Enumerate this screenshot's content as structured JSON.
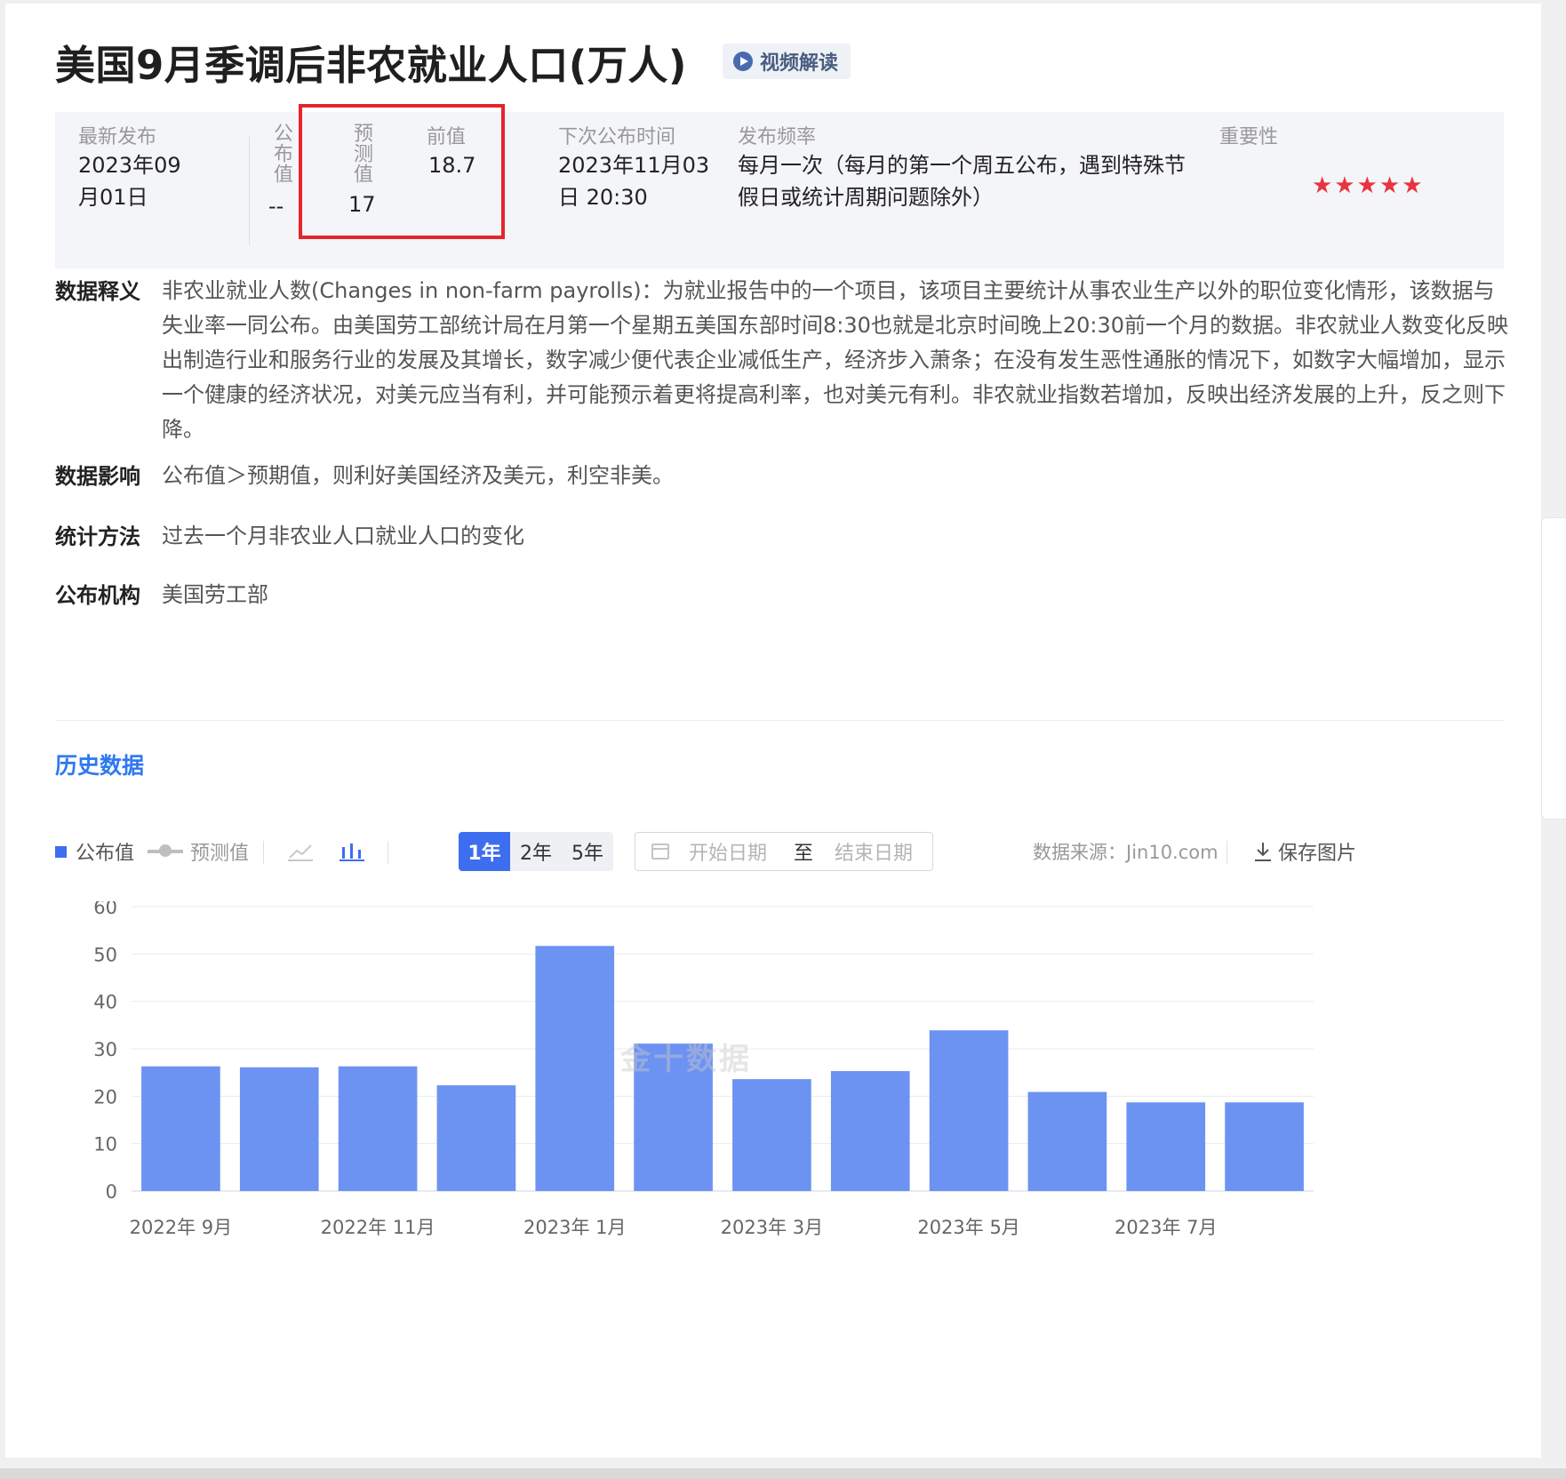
{
  "header": {
    "title": "美国9月季调后非农就业人口(万人)",
    "video_label": "视频解读"
  },
  "info": {
    "latest_label": "最新发布",
    "latest_value_line1": "2023年09",
    "latest_value_line2": "月01日",
    "actual_label": "公布值",
    "actual_value": "--",
    "forecast_label": "预测值",
    "forecast_value": "17",
    "previous_label": "前值",
    "previous_value": "18.7",
    "next_label": "下次公布时间",
    "next_value_line1": "2023年11月03",
    "next_value_line2": "日 20:30",
    "freq_label": "发布频率",
    "freq_value_line1": "每月一次（每月的第一个周五公布，遇到特殊节",
    "freq_value_line2": "假日或统计周期问题除外）",
    "importance_label": "重要性",
    "importance_stars": "★★★★★",
    "importance_color": "#e8343f"
  },
  "sections": {
    "definition_label": "数据释义",
    "definition_text": "非农业就业人数(Changes in non-farm payrolls)：为就业报告中的一个项目，该项目主要统计从事农业生产以外的职位变化情形，该数据与失业率一同公布。由美国劳工部统计局在月第一个星期五美国东部时间8:30也就是北京时间晚上20:30前一个月的数据。非农就业人数变化反映出制造行业和服务行业的发展及其增长，数字减少便代表企业减低生产，经济步入萧条；在没有发生恶性通胀的情况下，如数字大幅增加，显示一个健康的经济状况，对美元应当有利，并可能预示着更将提高利率，也对美元有利。非农就业指数若增加，反映出经济发展的上升，反之则下降。",
    "impact_label": "数据影响",
    "impact_text": "公布值＞预期值，则利好美国经济及美元，利空非美。",
    "method_label": "统计方法",
    "method_text": "过去一个月非农业人口就业人口的变化",
    "agency_label": "公布机构",
    "agency_text": "美国劳工部"
  },
  "history": {
    "title": "历史数据"
  },
  "toolbar": {
    "legend_actual": "公布值",
    "legend_forecast": "预测值",
    "range_1y": "1年",
    "range_2y": "2年",
    "range_5y": "5年",
    "start_placeholder": "开始日期",
    "to_label": "至",
    "end_placeholder": "结束日期",
    "source": "数据来源：Jin10.com",
    "save": "保存图片",
    "icons": [
      "line-chart-icon",
      "bar-chart-icon",
      "calendar-icon",
      "download-icon"
    ]
  },
  "watermark": "金十数据",
  "colors": {
    "accent": "#3e6ef0",
    "bar": "#6d93f2",
    "highlight_border": "#e5242b"
  },
  "chart_data": {
    "type": "bar",
    "categories": [
      "2022-09",
      "2022-10",
      "2022-11",
      "2022-12",
      "2023-01",
      "2023-02",
      "2023-03",
      "2023-04",
      "2023-05",
      "2023-06",
      "2023-07",
      "2023-08"
    ],
    "x_tick_labels": [
      "2022年 9月",
      "2022年 11月",
      "2023年 1月",
      "2023年 3月",
      "2023年 5月",
      "2023年 7月"
    ],
    "series": [
      {
        "name": "公布值",
        "values": [
          26.3,
          26.1,
          26.3,
          22.3,
          51.7,
          31.1,
          23.6,
          25.3,
          33.9,
          20.9,
          18.7,
          18.7
        ]
      }
    ],
    "ylim": [
      0,
      60
    ],
    "y_ticks": [
      0,
      10,
      20,
      30,
      40,
      50,
      60
    ],
    "grid": true
  }
}
